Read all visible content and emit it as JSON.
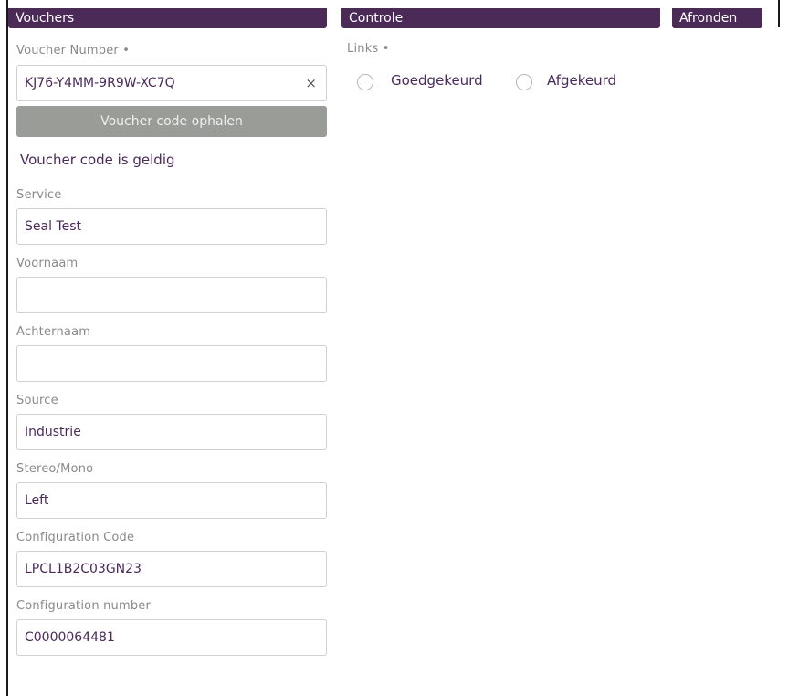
{
  "tabs": {
    "vouchers": "Vouchers",
    "controle": "Controle",
    "afronden": "Afronden"
  },
  "voucher": {
    "number_label": "Voucher Number •",
    "number_value": "KJ76-Y4MM-9R9W-XC7Q",
    "clear_symbol": "×",
    "fetch_button": "Voucher code ophalen",
    "valid_message": "Voucher code is geldig"
  },
  "fields": [
    {
      "label": "Service",
      "value": "Seal Test"
    },
    {
      "label": "Voornaam",
      "value": ""
    },
    {
      "label": "Achternaam",
      "value": ""
    },
    {
      "label": "Source",
      "value": "Industrie"
    },
    {
      "label": "Stereo/Mono",
      "value": "Left"
    },
    {
      "label": "Configuration Code",
      "value": "LPCL1B2C03GN23"
    },
    {
      "label": "Configuration number",
      "value": "C0000064481"
    }
  ],
  "controle": {
    "links_label": "Links •",
    "options": [
      "Goedgekeurd",
      "Afgekeurd"
    ]
  },
  "colors": {
    "header_bg": "#4b2a57",
    "button_bg": "#9a9c98",
    "text": "#4a2a5a"
  }
}
